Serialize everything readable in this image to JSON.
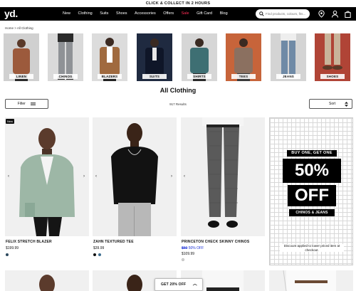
{
  "promo": {
    "text": "CLICK & COLLECT IN 2 HOURS"
  },
  "header": {
    "logo": "yd.",
    "nav": [
      "New",
      "Clothing",
      "Suits",
      "Shoes",
      "Accessories",
      "Offers",
      "Sale",
      "Gift Card",
      "Blog"
    ],
    "search_placeholder": "Find products, colours, fits..."
  },
  "breadcrumb": "Home > All Clothing",
  "categories": [
    {
      "label": "LINEN",
      "color": "#cfcfcf"
    },
    {
      "label": "CHINOS",
      "color": "#d6d6d6"
    },
    {
      "label": "BLAZERS",
      "color": "#d9d9d9"
    },
    {
      "label": "SUITS",
      "color": "#1e2a44"
    },
    {
      "label": "SHIRTS",
      "color": "#d4d4d4"
    },
    {
      "label": "TEES",
      "color": "#c9653a"
    },
    {
      "label": "JEANS",
      "color": "#d2d2d2"
    },
    {
      "label": "SHOES",
      "color": "#b04436"
    }
  ],
  "listing": {
    "title": "All Clothing",
    "filter_label": "Filter",
    "results": "917 Results",
    "sort_label": "Sort"
  },
  "products": [
    {
      "badge": "New",
      "name": "FELIX STRETCH BLAZER",
      "price": "$199.99",
      "swatches": [
        "#2d4a5e"
      ]
    },
    {
      "name": "ZAHN TEXTURED TEE",
      "price": "$39.99",
      "swatches": [
        "#111111",
        "#3d6e8f"
      ]
    },
    {
      "name": "PRINCETON CHECK SKINNY CHINOS",
      "old_price": "$60",
      "sale_label": "50% OFF",
      "price": "$109.99",
      "swatches": [
        "#dddddd"
      ]
    }
  ],
  "promo_card": {
    "line1": "BUY ONE, GET ONE",
    "big1": "50%",
    "big2": "OFF",
    "line2": "CHINOS & JEANS",
    "note": "Discount applied to lower priced item at checkout."
  },
  "discount_button": "GET 20% OFF",
  "colors": {
    "accent_sale": "#ff2d55",
    "sale_price": "#1a2fd6"
  }
}
